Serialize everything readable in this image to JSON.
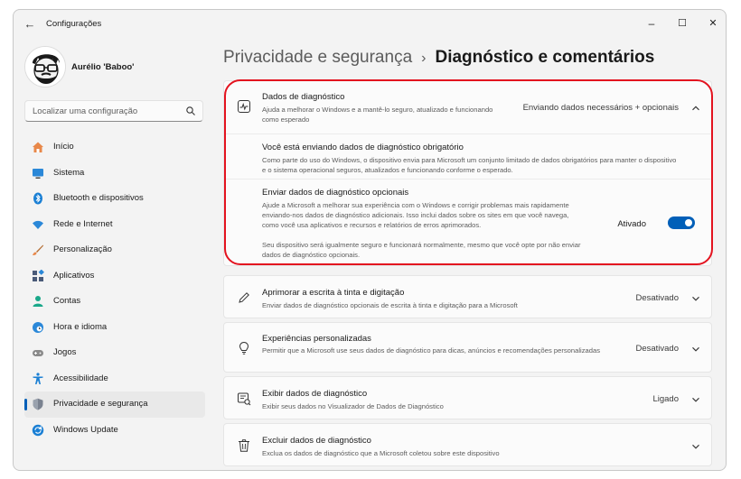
{
  "window": {
    "title": "Configurações",
    "minimize_glyph": "–",
    "maximize_glyph": "☐",
    "close_glyph": "✕",
    "back_glyph": "←"
  },
  "profile": {
    "name": "Aurélio 'Baboo'"
  },
  "search": {
    "placeholder": "Localizar uma configuração"
  },
  "sidebar": {
    "items": [
      {
        "label": "Início",
        "icon": "home-icon",
        "color": "#e07a3c"
      },
      {
        "label": "Sistema",
        "icon": "system-icon",
        "color": "#2b88d8"
      },
      {
        "label": "Bluetooth e dispositivos",
        "icon": "bluetooth-icon",
        "color": "#2b88d8"
      },
      {
        "label": "Rede e Internet",
        "icon": "wifi-icon",
        "color": "#2b88d8"
      },
      {
        "label": "Personalização",
        "icon": "brush-icon",
        "color": "#e07a3c"
      },
      {
        "label": "Aplicativos",
        "icon": "apps-icon",
        "color": "#4a5a78"
      },
      {
        "label": "Contas",
        "icon": "account-icon",
        "color": "#1aa88a"
      },
      {
        "label": "Hora e idioma",
        "icon": "clock-globe-icon",
        "color": "#2b88d8"
      },
      {
        "label": "Jogos",
        "icon": "gamepad-icon",
        "color": "#8a8a8a"
      },
      {
        "label": "Acessibilidade",
        "icon": "accessibility-icon",
        "color": "#1a7fd4"
      },
      {
        "label": "Privacidade e segurança",
        "icon": "shield-icon",
        "color": "#6b7280"
      },
      {
        "label": "Windows Update",
        "icon": "update-icon",
        "color": "#1a7fd4"
      }
    ],
    "active_index": 10
  },
  "breadcrumb": {
    "parent": "Privacidade e segurança",
    "separator": "›",
    "current": "Diagnóstico e comentários"
  },
  "cards": {
    "diagnostic_data": {
      "title": "Dados de diagnóstico",
      "desc": "Ajuda a melhorar o Windows e a mantê-lo seguro, atualizado e funcionando como esperado",
      "status": "Enviando dados necessários + opcionais",
      "expanded": true,
      "required": {
        "title": "Você está enviando dados de diagnóstico obrigatório",
        "desc": "Como parte do uso do Windows, o dispositivo envia para Microsoft um conjunto limitado de dados obrigatórios para manter o dispositivo e o sistema operacional seguros, atualizados e funcionando conforme o esperado."
      },
      "optional": {
        "title": "Enviar dados de diagnóstico opcionais",
        "desc": "Ajude a Microsoft a melhorar sua experiência com o Windows e corrigir problemas mais rapidamente enviando-nos dados de diagnóstico adicionais. Isso inclui dados sobre os sites em que você navega, como você usa aplicativos e recursos e relatórios de erros aprimorados.",
        "note": "Seu dispositivo será igualmente seguro e funcionará normalmente, mesmo que você opte por não enviar dados de diagnóstico opcionais.",
        "toggle_label": "Ativado",
        "toggle_on": true
      }
    },
    "inking": {
      "title": "Aprimorar a escrita à tinta e digitação",
      "desc": "Enviar dados de diagnóstico opcionais de escrita à tinta e digitação para a Microsoft",
      "status": "Desativado"
    },
    "tailored": {
      "title": "Experiências personalizadas",
      "desc": "Permitir que a Microsoft use seus dados de diagnóstico para dicas, anúncios e recomendações personalizadas",
      "status": "Desativado"
    },
    "viewer": {
      "title": "Exibir dados de diagnóstico",
      "desc": "Exibir seus dados no Visualizador de Dados de Diagnóstico",
      "status": "Ligado"
    },
    "delete": {
      "title": "Excluir dados de diagnóstico",
      "desc": "Exclua os dados de diagnóstico que a Microsoft coletou sobre este dispositivo"
    }
  },
  "colors": {
    "accent": "#005fb8",
    "highlight": "#e3131f"
  }
}
